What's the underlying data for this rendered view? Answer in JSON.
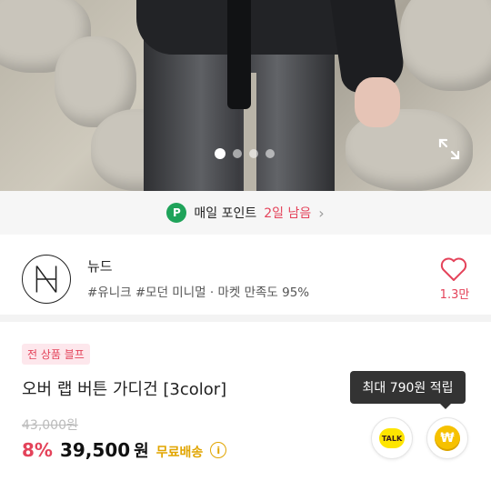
{
  "carousel": {
    "total": 4,
    "active": 0
  },
  "points_banner": {
    "label": "매일 포인트",
    "days_left": "2일 남음"
  },
  "store": {
    "name": "뉴드",
    "tags": "#유니크 #모던 미니멀 · 마켓 만족도 95%",
    "likes": "1.3만"
  },
  "product": {
    "badge": "전 상품 블프",
    "name": "오버 랩 버튼 가디건 [3color]",
    "original_price": "43,000원",
    "discount": "8%",
    "price": "39,500",
    "currency": "원",
    "shipping": "무료배송"
  },
  "reward_tooltip": "최대 790원 적립",
  "actions": {
    "talk_label": "TALK",
    "coin_label": "₩"
  },
  "colors": {
    "accent": "#e4435a",
    "shipping": "#e1a500",
    "points": "#1fa35a"
  }
}
